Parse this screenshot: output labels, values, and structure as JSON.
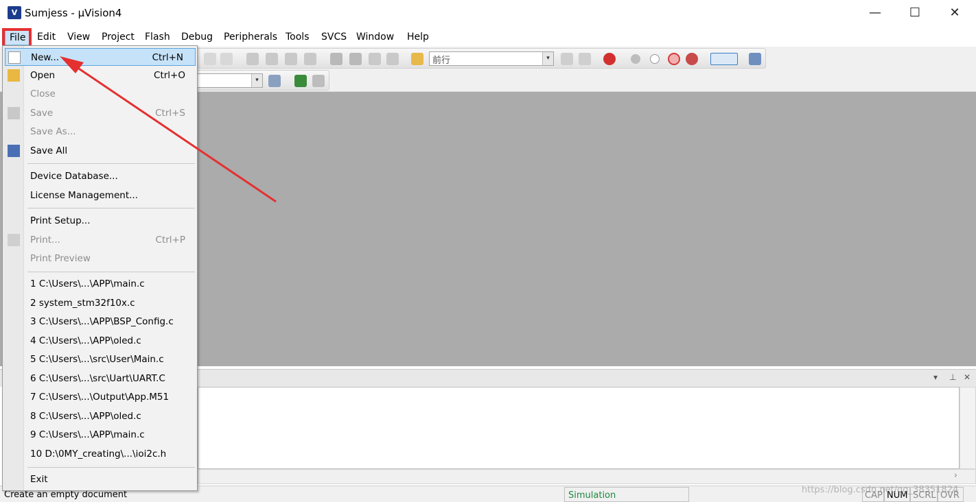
{
  "window": {
    "title": "Sumjess  - µVision4",
    "app_icon": "uv4-app-icon",
    "controls": {
      "minimize": "—",
      "maximize": "☐",
      "close": "✕"
    }
  },
  "menubar": {
    "items": [
      {
        "label": "File"
      },
      {
        "label": "Edit"
      },
      {
        "label": "View"
      },
      {
        "label": "Project"
      },
      {
        "label": "Flash"
      },
      {
        "label": "Debug"
      },
      {
        "label": "Peripherals"
      },
      {
        "label": "Tools"
      },
      {
        "label": "SVCS"
      },
      {
        "label": "Window"
      },
      {
        "label": "Help"
      }
    ]
  },
  "toolbar": {
    "find_combo_value": "前行",
    "dropdown_glyph": "▾"
  },
  "file_menu": {
    "items": [
      {
        "label": "New...",
        "shortcut": "Ctrl+N",
        "state": "selected"
      },
      {
        "label": "Open",
        "shortcut": "Ctrl+O",
        "state": "enabled"
      },
      {
        "label": "Close",
        "shortcut": "",
        "state": "disabled"
      },
      {
        "label": "Save",
        "shortcut": "Ctrl+S",
        "state": "disabled"
      },
      {
        "label": "Save As...",
        "shortcut": "",
        "state": "disabled"
      },
      {
        "label": "Save All",
        "shortcut": "",
        "state": "enabled"
      },
      {
        "label": "Device Database...",
        "shortcut": "",
        "state": "enabled"
      },
      {
        "label": "License Management...",
        "shortcut": "",
        "state": "enabled"
      },
      {
        "label": "Print Setup...",
        "shortcut": "",
        "state": "enabled"
      },
      {
        "label": "Print...",
        "shortcut": "Ctrl+P",
        "state": "disabled"
      },
      {
        "label": "Print Preview",
        "shortcut": "",
        "state": "disabled"
      },
      {
        "label": "1 C:\\Users\\...\\APP\\main.c",
        "shortcut": "",
        "state": "enabled"
      },
      {
        "label": "2 system_stm32f10x.c",
        "shortcut": "",
        "state": "enabled"
      },
      {
        "label": "3 C:\\Users\\...\\APP\\BSP_Config.c",
        "shortcut": "",
        "state": "enabled"
      },
      {
        "label": "4 C:\\Users\\...\\APP\\oled.c",
        "shortcut": "",
        "state": "enabled"
      },
      {
        "label": "5 C:\\Users\\...\\src\\User\\Main.c",
        "shortcut": "",
        "state": "enabled"
      },
      {
        "label": "6 C:\\Users\\...\\src\\Uart\\UART.C",
        "shortcut": "",
        "state": "enabled"
      },
      {
        "label": "7 C:\\Users\\...\\Output\\App.M51",
        "shortcut": "",
        "state": "enabled"
      },
      {
        "label": "8 C:\\Users\\...\\APP\\oled.c",
        "shortcut": "",
        "state": "enabled"
      },
      {
        "label": "9 C:\\Users\\...\\APP\\main.c",
        "shortcut": "",
        "state": "enabled"
      },
      {
        "label": "10 D:\\0MY_creating\\...\\ioi2c.h",
        "shortcut": "",
        "state": "enabled"
      },
      {
        "label": "Exit",
        "shortcut": "",
        "state": "enabled"
      }
    ]
  },
  "output_pane": {
    "controls": {
      "dropdown": "▾",
      "pin": "⊥",
      "close": "✕"
    },
    "scroll_right": "›"
  },
  "statusbar": {
    "message": "Create an empty document",
    "mode": "Simulation",
    "indicators": {
      "cap": "CAP",
      "num": "NUM",
      "scrl": "SCRL",
      "ovr": "OVR"
    }
  },
  "watermark": "https://blog.csdn.net/qq_38351824",
  "colors": {
    "annotation_red": "#e53030",
    "menu_highlight": "#c6e2f9",
    "editor_gray": "#ababab",
    "simulation_green": "#1a8a3c"
  }
}
